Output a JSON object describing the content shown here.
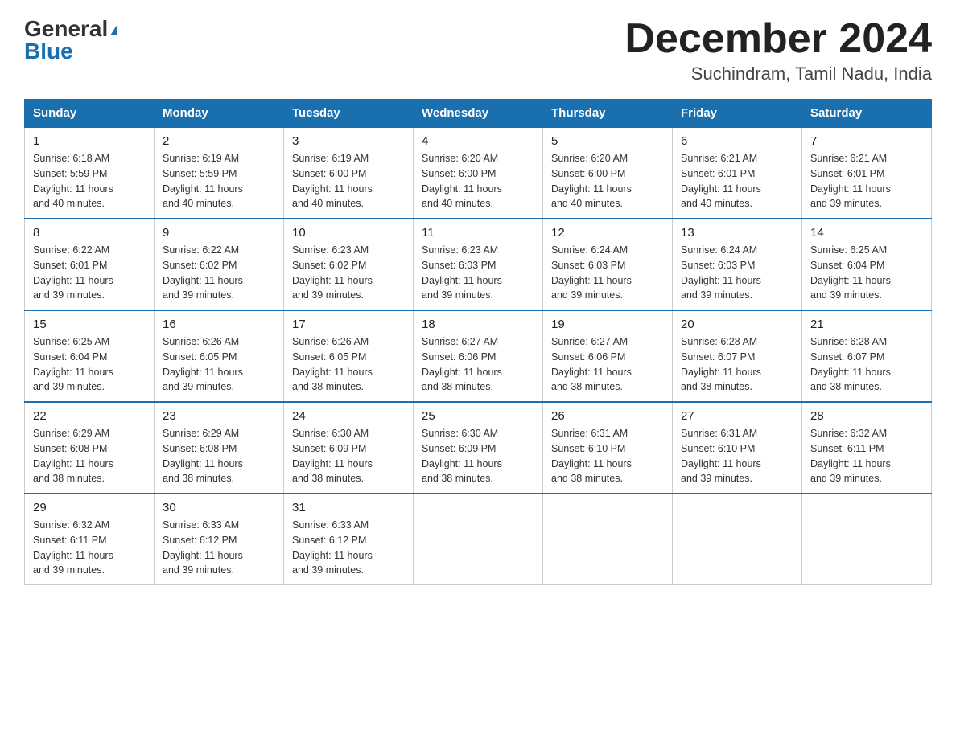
{
  "header": {
    "logo_general": "General",
    "logo_blue": "Blue",
    "month_title": "December 2024",
    "subtitle": "Suchindram, Tamil Nadu, India"
  },
  "days_of_week": [
    "Sunday",
    "Monday",
    "Tuesday",
    "Wednesday",
    "Thursday",
    "Friday",
    "Saturday"
  ],
  "weeks": [
    [
      {
        "day": 1,
        "sunrise": "6:18 AM",
        "sunset": "5:59 PM",
        "daylight": "11 hours and 40 minutes."
      },
      {
        "day": 2,
        "sunrise": "6:19 AM",
        "sunset": "5:59 PM",
        "daylight": "11 hours and 40 minutes."
      },
      {
        "day": 3,
        "sunrise": "6:19 AM",
        "sunset": "6:00 PM",
        "daylight": "11 hours and 40 minutes."
      },
      {
        "day": 4,
        "sunrise": "6:20 AM",
        "sunset": "6:00 PM",
        "daylight": "11 hours and 40 minutes."
      },
      {
        "day": 5,
        "sunrise": "6:20 AM",
        "sunset": "6:00 PM",
        "daylight": "11 hours and 40 minutes."
      },
      {
        "day": 6,
        "sunrise": "6:21 AM",
        "sunset": "6:01 PM",
        "daylight": "11 hours and 40 minutes."
      },
      {
        "day": 7,
        "sunrise": "6:21 AM",
        "sunset": "6:01 PM",
        "daylight": "11 hours and 39 minutes."
      }
    ],
    [
      {
        "day": 8,
        "sunrise": "6:22 AM",
        "sunset": "6:01 PM",
        "daylight": "11 hours and 39 minutes."
      },
      {
        "day": 9,
        "sunrise": "6:22 AM",
        "sunset": "6:02 PM",
        "daylight": "11 hours and 39 minutes."
      },
      {
        "day": 10,
        "sunrise": "6:23 AM",
        "sunset": "6:02 PM",
        "daylight": "11 hours and 39 minutes."
      },
      {
        "day": 11,
        "sunrise": "6:23 AM",
        "sunset": "6:03 PM",
        "daylight": "11 hours and 39 minutes."
      },
      {
        "day": 12,
        "sunrise": "6:24 AM",
        "sunset": "6:03 PM",
        "daylight": "11 hours and 39 minutes."
      },
      {
        "day": 13,
        "sunrise": "6:24 AM",
        "sunset": "6:03 PM",
        "daylight": "11 hours and 39 minutes."
      },
      {
        "day": 14,
        "sunrise": "6:25 AM",
        "sunset": "6:04 PM",
        "daylight": "11 hours and 39 minutes."
      }
    ],
    [
      {
        "day": 15,
        "sunrise": "6:25 AM",
        "sunset": "6:04 PM",
        "daylight": "11 hours and 39 minutes."
      },
      {
        "day": 16,
        "sunrise": "6:26 AM",
        "sunset": "6:05 PM",
        "daylight": "11 hours and 39 minutes."
      },
      {
        "day": 17,
        "sunrise": "6:26 AM",
        "sunset": "6:05 PM",
        "daylight": "11 hours and 38 minutes."
      },
      {
        "day": 18,
        "sunrise": "6:27 AM",
        "sunset": "6:06 PM",
        "daylight": "11 hours and 38 minutes."
      },
      {
        "day": 19,
        "sunrise": "6:27 AM",
        "sunset": "6:06 PM",
        "daylight": "11 hours and 38 minutes."
      },
      {
        "day": 20,
        "sunrise": "6:28 AM",
        "sunset": "6:07 PM",
        "daylight": "11 hours and 38 minutes."
      },
      {
        "day": 21,
        "sunrise": "6:28 AM",
        "sunset": "6:07 PM",
        "daylight": "11 hours and 38 minutes."
      }
    ],
    [
      {
        "day": 22,
        "sunrise": "6:29 AM",
        "sunset": "6:08 PM",
        "daylight": "11 hours and 38 minutes."
      },
      {
        "day": 23,
        "sunrise": "6:29 AM",
        "sunset": "6:08 PM",
        "daylight": "11 hours and 38 minutes."
      },
      {
        "day": 24,
        "sunrise": "6:30 AM",
        "sunset": "6:09 PM",
        "daylight": "11 hours and 38 minutes."
      },
      {
        "day": 25,
        "sunrise": "6:30 AM",
        "sunset": "6:09 PM",
        "daylight": "11 hours and 38 minutes."
      },
      {
        "day": 26,
        "sunrise": "6:31 AM",
        "sunset": "6:10 PM",
        "daylight": "11 hours and 38 minutes."
      },
      {
        "day": 27,
        "sunrise": "6:31 AM",
        "sunset": "6:10 PM",
        "daylight": "11 hours and 39 minutes."
      },
      {
        "day": 28,
        "sunrise": "6:32 AM",
        "sunset": "6:11 PM",
        "daylight": "11 hours and 39 minutes."
      }
    ],
    [
      {
        "day": 29,
        "sunrise": "6:32 AM",
        "sunset": "6:11 PM",
        "daylight": "11 hours and 39 minutes."
      },
      {
        "day": 30,
        "sunrise": "6:33 AM",
        "sunset": "6:12 PM",
        "daylight": "11 hours and 39 minutes."
      },
      {
        "day": 31,
        "sunrise": "6:33 AM",
        "sunset": "6:12 PM",
        "daylight": "11 hours and 39 minutes."
      },
      null,
      null,
      null,
      null
    ]
  ],
  "labels": {
    "sunrise": "Sunrise:",
    "sunset": "Sunset:",
    "daylight": "Daylight:"
  }
}
